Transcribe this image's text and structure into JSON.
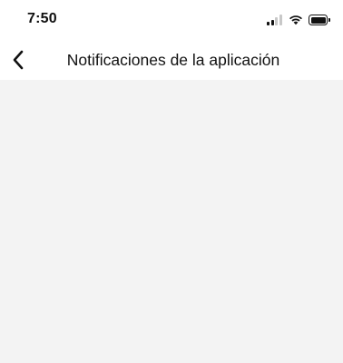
{
  "status_bar": {
    "time": "7:50",
    "icons": [
      "cellular-signal-icon",
      "wifi-icon",
      "battery-icon"
    ]
  },
  "nav": {
    "back_icon": "chevron-left-icon",
    "title": "Notificaciones de la aplicación"
  },
  "content": {
    "background_color": "#f3f3f3"
  }
}
